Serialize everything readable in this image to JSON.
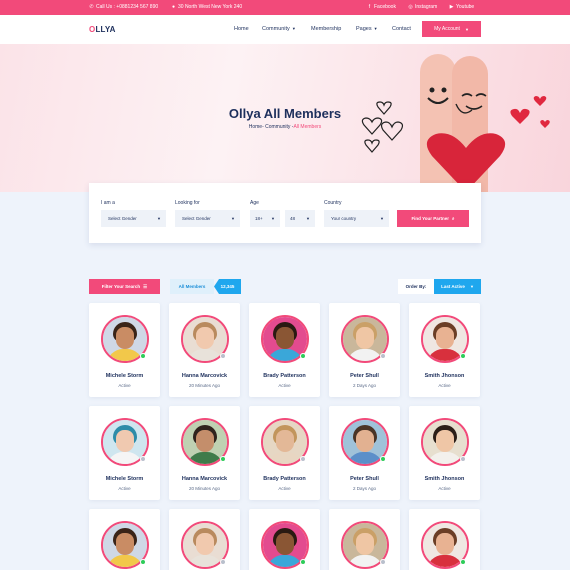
{
  "topbar": {
    "phone": "Call Us : +0881234 567 890",
    "address": "30 North West New York 240",
    "facebook": "Facebook",
    "instagram": "Instagram",
    "youtube": "Youtube"
  },
  "header": {
    "logo_accent": "O",
    "logo_rest": "LLYA",
    "nav": [
      "Home",
      "Community",
      "Membership",
      "Pages",
      "Contact"
    ],
    "account_label": "My Account"
  },
  "hero": {
    "title": "Ollya All Members",
    "crumb_home": "Home",
    "crumb_community": "Community",
    "crumb_active": "All Members"
  },
  "filter": {
    "iam_label": "I am a",
    "iam_value": "Select Gender",
    "looking_label": "Looking for",
    "looking_value": "Select Gender",
    "age_label": "Age",
    "age_min": "18+",
    "age_max": "48",
    "country_label": "Country",
    "country_value": "Your country",
    "submit_label": "Find Your Partner"
  },
  "toolbar": {
    "filter_label": "Filter Your Search",
    "all_members_label": "All Members",
    "member_count": "12,345",
    "order_label": "Order By:",
    "order_value": "Last Active"
  },
  "members": [
    {
      "name": "Michele Storm",
      "status": "Active",
      "online": true,
      "skin": "#c98c64",
      "hair": "#3a2418",
      "shirt": "#f2c84a",
      "bg": "#cfd8e6"
    },
    {
      "name": "Hanna Marcovick",
      "status": "20 Minutes Ago",
      "online": false,
      "skin": "#f1c9ae",
      "hair": "#b98a5e",
      "shirt": "#e8e2da",
      "bg": "#e9ddd3"
    },
    {
      "name": "Brady Patterson",
      "status": "Active",
      "online": true,
      "skin": "#8a5634",
      "hair": "#2a1a12",
      "shirt": "#3aa7d9",
      "bg": "#e34b8f"
    },
    {
      "name": "Peter Shull",
      "status": "2 Days Ago",
      "online": false,
      "skin": "#efc6a4",
      "hair": "#caa067",
      "shirt": "#f2f2f2",
      "bg": "#c9b79b"
    },
    {
      "name": "Smith Jhonson",
      "status": "Active",
      "online": true,
      "skin": "#e8b292",
      "hair": "#6b3e26",
      "shirt": "#d8303d",
      "bg": "#efe7e2"
    },
    {
      "name": "Michele Storm",
      "status": "Active",
      "online": false,
      "skin": "#f0c9b0",
      "hair": "#2d8ca8",
      "shirt": "#f5f5f5",
      "bg": "#cfe6ef"
    },
    {
      "name": "Hanna Marcovick",
      "status": "20 Minutes Ago",
      "online": true,
      "skin": "#c48e6b",
      "hair": "#2f231d",
      "shirt": "#3f7b4a",
      "bg": "#bfd1b2"
    },
    {
      "name": "Brady Patterson",
      "status": "Active",
      "online": false,
      "skin": "#e3b897",
      "hair": "#c2955c",
      "shirt": "#e8d6c2",
      "bg": "#e6d7c4"
    },
    {
      "name": "Peter Shull",
      "status": "2 Days Ago",
      "online": true,
      "skin": "#e2b191",
      "hair": "#4a3426",
      "shirt": "#5b8fc9",
      "bg": "#9fc2d9"
    },
    {
      "name": "Smith Jhonson",
      "status": "Active",
      "online": false,
      "skin": "#efc6a6",
      "hair": "#2c1f18",
      "shirt": "#f3f0ec",
      "bg": "#e7dfcf"
    },
    {
      "name": "",
      "status": "",
      "online": true,
      "skin": "#c98c64",
      "hair": "#3a2418",
      "shirt": "#f2c84a",
      "bg": "#cfd8e6"
    },
    {
      "name": "",
      "status": "",
      "online": false,
      "skin": "#f1c9ae",
      "hair": "#b98a5e",
      "shirt": "#e8e2da",
      "bg": "#e9ddd3"
    },
    {
      "name": "",
      "status": "",
      "online": true,
      "skin": "#8a5634",
      "hair": "#2a1a12",
      "shirt": "#3aa7d9",
      "bg": "#e34b8f"
    },
    {
      "name": "",
      "status": "",
      "online": false,
      "skin": "#efc6a4",
      "hair": "#caa067",
      "shirt": "#f2f2f2",
      "bg": "#c9b79b"
    },
    {
      "name": "",
      "status": "",
      "online": true,
      "skin": "#e8b292",
      "hair": "#6b3e26",
      "shirt": "#d8303d",
      "bg": "#efe7e2"
    }
  ],
  "colors": {
    "accent": "#f24a7a",
    "blue": "#1fa7ee",
    "navy": "#1d2f5c",
    "online": "#2ecc5a",
    "offline": "#b9c0cc"
  }
}
